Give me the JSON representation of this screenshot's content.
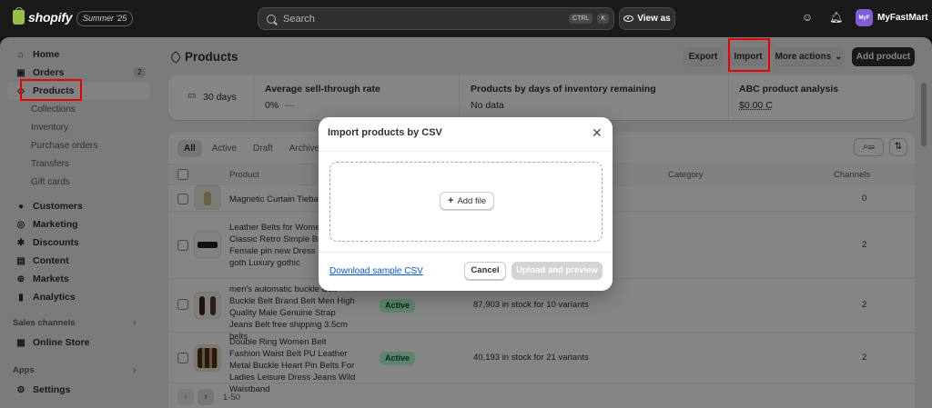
{
  "topbar": {
    "logo": "shopify",
    "edition": "Summer '25",
    "search_placeholder": "Search",
    "kbd1": "CTRL",
    "kbd2": "K",
    "view_as": "View as",
    "store_initials": "MyF",
    "store_name": "MyFastMart",
    "icons": [
      "eye-icon",
      "support-icon",
      "bell-icon"
    ]
  },
  "sidebar": {
    "home": "Home",
    "orders": "Orders",
    "orders_count": "2",
    "products": "Products",
    "product_subs": [
      "Collections",
      "Inventory",
      "Purchase orders",
      "Transfers",
      "Gift cards"
    ],
    "customers": "Customers",
    "marketing": "Marketing",
    "discounts": "Discounts",
    "content": "Content",
    "markets": "Markets",
    "analytics": "Analytics",
    "sales_channels": "Sales channels",
    "online_store": "Online Store",
    "apps": "Apps",
    "settings": "Settings"
  },
  "page": {
    "title": "Products",
    "export": "Export",
    "import": "Import",
    "more_actions": "More actions",
    "add_product": "Add product"
  },
  "stats": {
    "period": "30 days",
    "sell_through_label": "Average sell-through rate",
    "sell_through_value": "0%",
    "sell_through_trend": "—",
    "days_label": "Products by days of inventory remaining",
    "days_value": "No data",
    "abc_label": "ABC product analysis",
    "abc_value": "$0.00 C"
  },
  "table": {
    "tabs": [
      "All",
      "Active",
      "Draft",
      "Archived"
    ],
    "headers": {
      "product": "Product",
      "category": "Category",
      "channels": "Channels"
    },
    "rows": [
      {
        "name": "Magnetic Curtain Tieback",
        "status": "",
        "inventory": "",
        "channels": "0"
      },
      {
        "name": "Leather Belts for Women Jeans Classic Retro Simple Buckle Female pin new Dress Sword goth Luxury gothic",
        "status": "",
        "inventory": "",
        "channels": "2"
      },
      {
        "name": "men's automatic buckle Belt Buckle Belt Brand Belt Men High Quality Male Genuine Strap Jeans Belt free shipping 3.5cm belts",
        "status": "Active",
        "inventory": "87,903 in stock for 10 variants",
        "channels": "2"
      },
      {
        "name": "Double Ring Women Belt Fashion Waist Belt PU Leather Metal Buckle Heart Pin Belts For Ladies Leisure Dress Jeans Wild Waistband",
        "status": "Active",
        "inventory": "40,193 in stock for 21 variants",
        "channels": "2"
      }
    ],
    "pagination": "1-50"
  },
  "modal": {
    "title": "Import products by CSV",
    "add_file": "Add file",
    "download_sample": "Download sample CSV",
    "cancel": "Cancel",
    "upload": "Upload and preview"
  }
}
